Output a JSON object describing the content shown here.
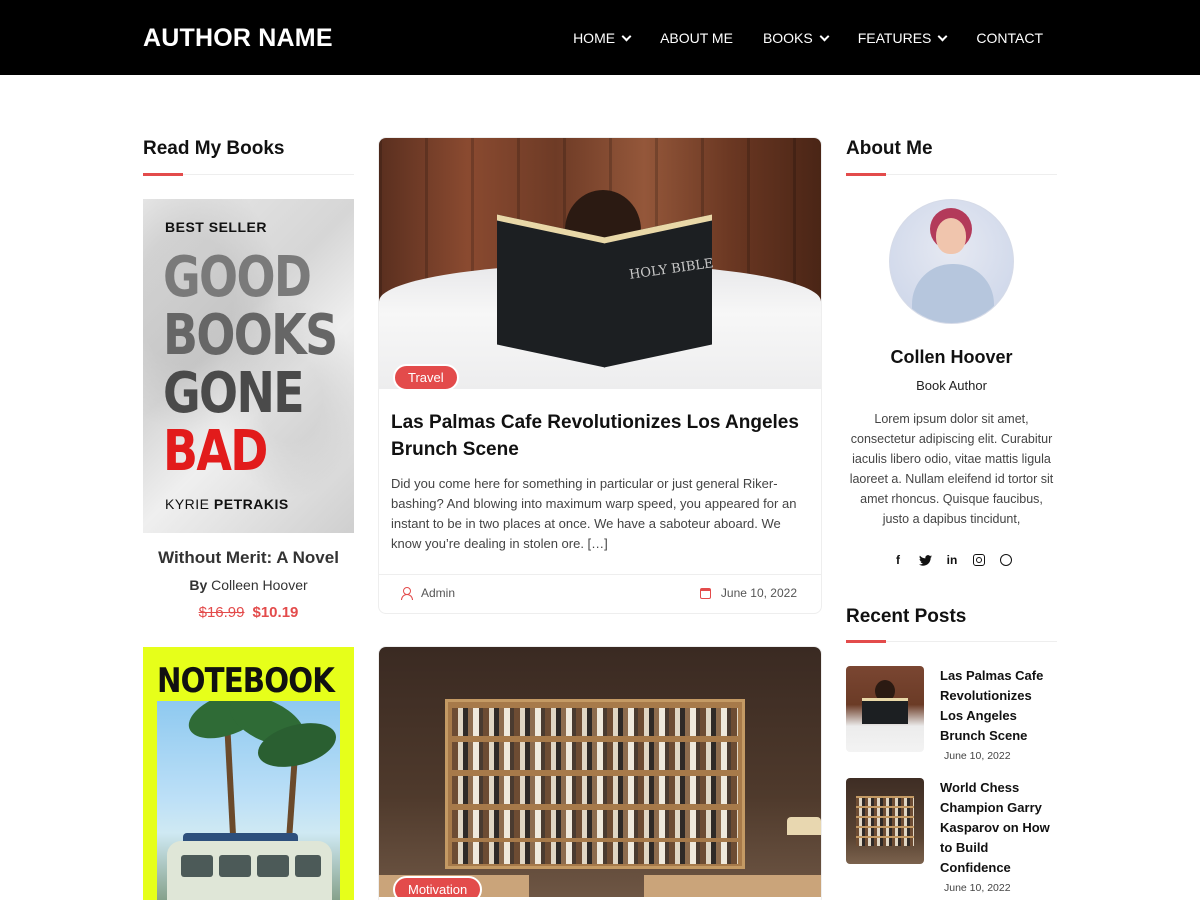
{
  "header": {
    "brand": "AUTHOR NAME",
    "nav": [
      {
        "label": "HOME",
        "has_dropdown": true
      },
      {
        "label": "ABOUT ME",
        "has_dropdown": false
      },
      {
        "label": "BOOKS",
        "has_dropdown": true
      },
      {
        "label": "FEATURES",
        "has_dropdown": true
      },
      {
        "label": "CONTACT",
        "has_dropdown": false
      }
    ]
  },
  "books_section": {
    "title": "Read My Books",
    "books": [
      {
        "cover": {
          "badge": "BEST SELLER",
          "line1": "GOOD",
          "line2": "BOOKS",
          "line3": "GONE",
          "line4": "BAD",
          "author_first": "KYRIE",
          "author_last": "PETRAKIS"
        },
        "title": "Without Merit: A Novel",
        "by_label": "By",
        "author": "Colleen Hoover",
        "old_price": "$16.99",
        "price": "$10.19"
      },
      {
        "cover": {
          "title": "NOTEBOOK"
        }
      }
    ]
  },
  "posts": [
    {
      "category": "Travel",
      "title": "Las Palmas Cafe Revolutionizes Los Angeles Brunch Scene",
      "excerpt": "Did you come here for something in particular or just general Riker-bashing? And blowing into maximum warp speed, you appeared for an instant to be in two places at once. We have a saboteur aboard. We know you’re dealing in stolen ore. […]",
      "author": "Admin",
      "date": "June 10, 2022",
      "image_text": "HOLY BIBLE"
    },
    {
      "category": "Motivation"
    }
  ],
  "about": {
    "title": "About Me",
    "name": "Collen Hoover",
    "role": "Book Author",
    "bio": "Lorem ipsum dolor sit amet, consectetur adipiscing elit. Curabitur iaculis libero odio, vitae mattis ligula laoreet a. Nullam eleifend id tortor sit amet rhoncus. Quisque faucibus, justo a dapibus tincidunt,",
    "socials": [
      "facebook-icon",
      "twitter-icon",
      "linkedin-icon",
      "instagram-icon",
      "pinterest-icon"
    ]
  },
  "recent_posts": {
    "title": "Recent Posts",
    "items": [
      {
        "title": "Las Palmas Cafe Revolutionizes Los Angeles Brunch Scene",
        "date": "June 10, 2022"
      },
      {
        "title": "World Chess Champion Garry Kasparov on How to Build Confidence",
        "date": "June 10, 2022"
      }
    ]
  },
  "colors": {
    "accent": "#e34b4b",
    "header_bg": "#000000"
  }
}
